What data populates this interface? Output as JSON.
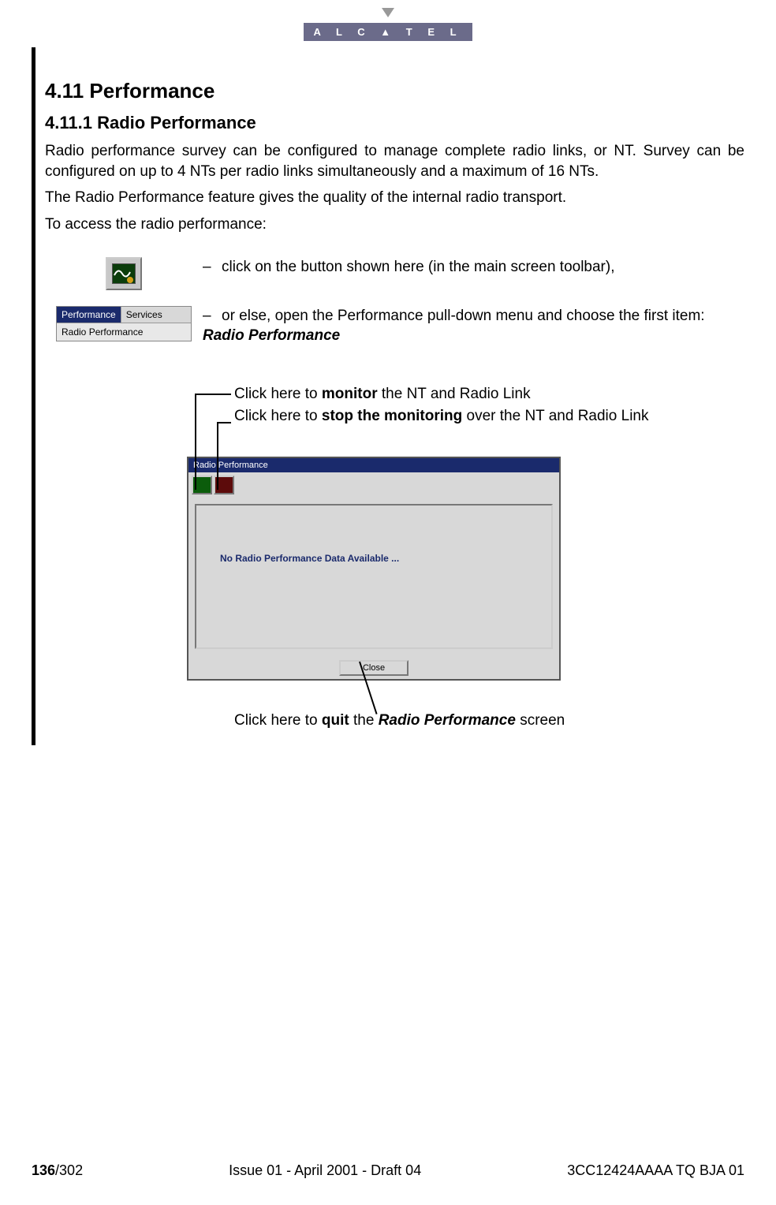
{
  "logo": {
    "brand": "A L C ▲ T E L"
  },
  "heading1": "4.11 Performance",
  "heading2": "4.11.1   Radio Performance",
  "para1": "Radio performance survey can be configured to manage complete radio links, or NT. Survey can be configured on up to 4 NTs per radio links simultaneously and a maximum of 16 NTs.",
  "para2": "The Radio Performance feature gives the quality of the internal radio transport.",
  "para3": "To access the radio performance:",
  "bullet1": "click on the button shown here (in the main screen toolbar),",
  "bullet2a": "or else, open the Performance pull-down menu and choose the first item: ",
  "bullet2b": "Radio Performance",
  "menu": {
    "performance": "Performance",
    "services": "Services",
    "item1": "Radio Performance"
  },
  "callout1_pre": "Click here to ",
  "callout1_bold": "monitor",
  "callout1_post": " the NT and Radio Link",
  "callout2_pre": "Click here to ",
  "callout2_bold": "stop the monitoring",
  "callout2_post": " over the NT and Radio Link",
  "window": {
    "title": "Radio Performance",
    "message": "No Radio Performance Data Available ...",
    "close": "Close"
  },
  "callout3_pre": "Click here to ",
  "callout3_b1": "quit",
  "callout3_mid": " the ",
  "callout3_b2": "Radio Performance",
  "callout3_post": " screen",
  "footer": {
    "page_bold": "136",
    "page_total": "/302",
    "center": "Issue 01 - April 2001 - Draft 04",
    "right": "3CC12424AAAA TQ BJA 01"
  }
}
